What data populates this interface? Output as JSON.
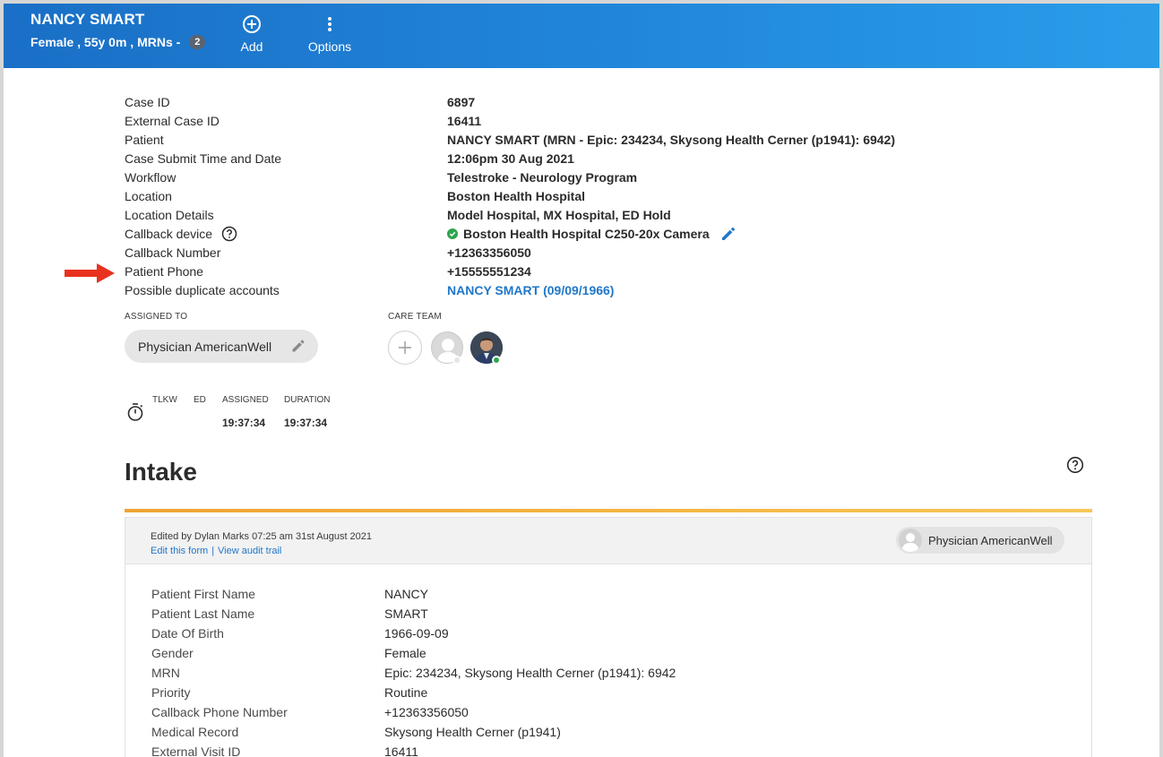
{
  "header": {
    "patient_name": "NANCY SMART",
    "patient_meta": "Female , 55y 0m , MRNs -",
    "mrn_count": "2",
    "add_label": "Add",
    "options_label": "Options"
  },
  "case_info": [
    {
      "label": "Case ID",
      "value": "6897"
    },
    {
      "label": "External Case ID",
      "value": "16411"
    },
    {
      "label": "Patient",
      "value": "NANCY SMART (MRN - Epic: 234234, Skysong Health Cerner (p1941): 6942)"
    },
    {
      "label": "Case Submit Time and Date",
      "value": "12:06pm 30 Aug 2021"
    },
    {
      "label": "Workflow",
      "value": "Telestroke - Neurology Program"
    },
    {
      "label": "Location",
      "value": "Boston Health Hospital"
    },
    {
      "label": "Location Details",
      "value": "Model Hospital, MX Hospital, ED Hold"
    },
    {
      "label": "Callback device",
      "value": "Boston Health Hospital C250-20x Camera"
    },
    {
      "label": "Callback Number",
      "value": "+12363356050"
    },
    {
      "label": "Patient Phone",
      "value": "+15555551234"
    },
    {
      "label": "Possible duplicate accounts",
      "value": "NANCY SMART (09/09/1966)"
    }
  ],
  "assignment": {
    "assigned_to_label": "ASSIGNED TO",
    "assigned_to": "Physician AmericanWell",
    "care_team_label": "CARE TEAM"
  },
  "timers": {
    "tlkw_label": "TLKW",
    "ed_label": "ED",
    "assigned_label": "ASSIGNED",
    "duration_label": "DURATION",
    "assigned_value": "19:37:34",
    "duration_value": "19:37:34"
  },
  "intake": {
    "title": "Intake",
    "edited_by": "Edited by Dylan Marks 07:25 am 31st August 2021",
    "edit_form_link": "Edit this form",
    "audit_trail_link": "View audit trail",
    "separator": "|",
    "owner": "Physician AmericanWell",
    "rows": [
      {
        "label": "Patient First Name",
        "value": "NANCY"
      },
      {
        "label": "Patient Last Name",
        "value": "SMART"
      },
      {
        "label": "Date Of Birth",
        "value": "1966-09-09"
      },
      {
        "label": "Gender",
        "value": "Female"
      },
      {
        "label": "MRN",
        "value": "Epic: 234234, Skysong Health Cerner (p1941): 6942"
      },
      {
        "label": "Priority",
        "value": "Routine"
      },
      {
        "label": "Callback Phone Number",
        "value": "+12363356050"
      },
      {
        "label": "Medical Record",
        "value": "Skysong Health Cerner (p1941)"
      },
      {
        "label": "External Visit ID",
        "value": "16411"
      }
    ]
  },
  "colors": {
    "header_start": "#1a6fc6",
    "header_end": "#2a9de9",
    "link_blue": "#1f77c9",
    "accent_orange": "#f0a335",
    "status_green": "#2ea44f",
    "arrow_red": "#e8321e"
  },
  "icons": {
    "add": "plus-circle-icon",
    "options": "vertical-dots-icon",
    "help": "question-circle-icon",
    "online": "green-check-icon",
    "edit": "pencil-icon",
    "timer": "stopwatch-icon",
    "annotation": "red-arrow-icon"
  }
}
